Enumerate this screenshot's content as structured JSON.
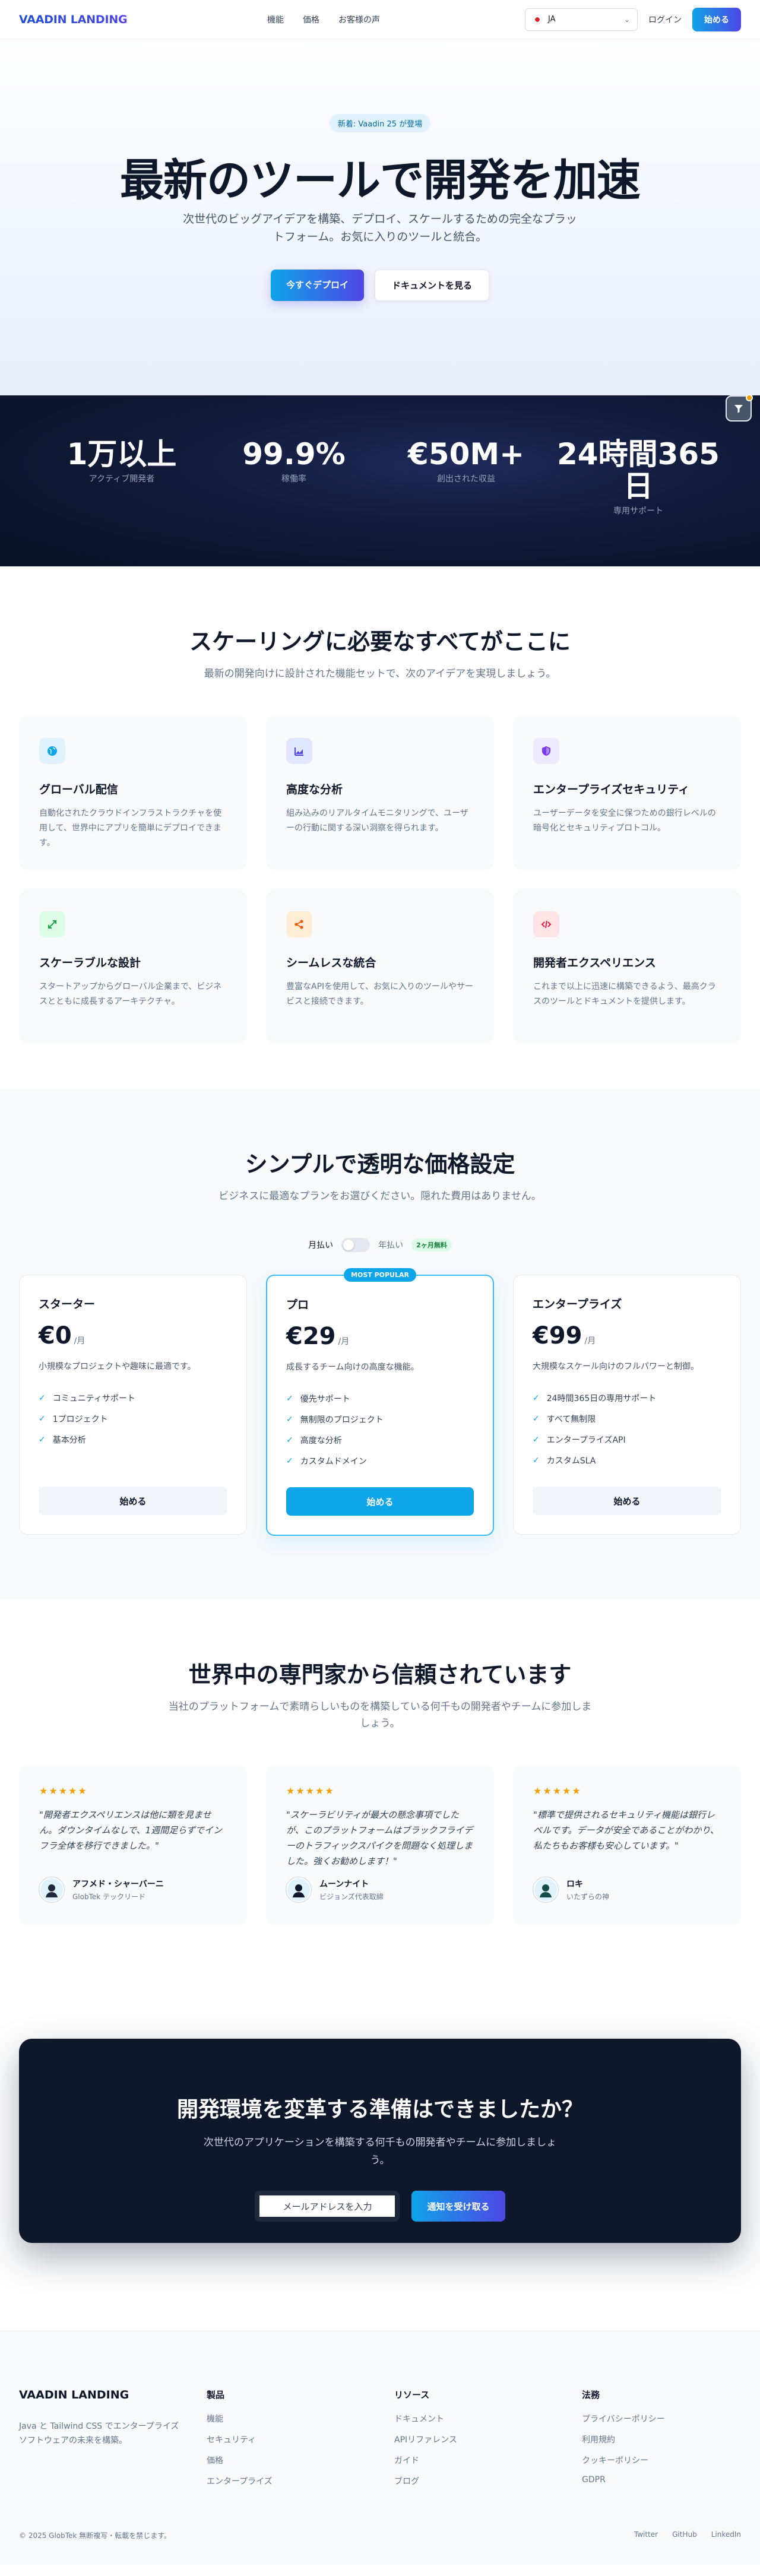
{
  "nav": {
    "logo": "VAADIN LANDING",
    "links": [
      "機能",
      "価格",
      "お客様の声"
    ],
    "language": "JA",
    "login": "ログイン",
    "start": "始める"
  },
  "hero": {
    "badge": "新着: Vaadin 25 が登場",
    "title": "最新のツールで開発を加速",
    "subtitle": "次世代のビッグアイデアを構築、デプロイ、スケールするための完全なプラットフォーム。お気に入りのツールと統合。",
    "primary_cta": "今すぐデプロイ",
    "secondary_cta": "ドキュメントを見る"
  },
  "stats": [
    {
      "value": "1万以上",
      "label": "アクティブ開発者"
    },
    {
      "value": "99.9%",
      "label": "稼働率"
    },
    {
      "value": "€50M+",
      "label": "創出された収益"
    },
    {
      "value": "24時間365日",
      "label": "専用サポート"
    }
  ],
  "features": {
    "title": "スケーリングに必要なすべてがここに",
    "subtitle": "最新の開発向けに設計された機能セットで、次のアイデアを実現しましょう。",
    "items": [
      {
        "icon": "globe-icon",
        "color": "#0ea5e9",
        "bg": "#e0f2fe",
        "title": "グローバル配信",
        "desc": "自動化されたクラウドインフラストラクチャを使用して、世界中にアプリを簡単にデプロイできます。"
      },
      {
        "icon": "chart-icon",
        "color": "#4f46e5",
        "bg": "#e0e7ff",
        "title": "高度な分析",
        "desc": "組み込みのリアルタイムモニタリングで、ユーザーの行動に関する深い洞察を得られます。"
      },
      {
        "icon": "shield-icon",
        "color": "#7c3aed",
        "bg": "#ede9fe",
        "title": "エンタープライズセキュリティ",
        "desc": "ユーザーデータを安全に保つための銀行レベルの暗号化とセキュリティプロトコル。"
      },
      {
        "icon": "scale-icon",
        "color": "#16a34a",
        "bg": "#dcfce7",
        "title": "スケーラブルな設計",
        "desc": "スタートアップからグローバル企業まで、ビジネスとともに成長するアーキテクチャ。"
      },
      {
        "icon": "share-icon",
        "color": "#ea580c",
        "bg": "#ffedd5",
        "title": "シームレスな統合",
        "desc": "豊富なAPIを使用して、お気に入りのツールやサービスと接続できます。"
      },
      {
        "icon": "code-icon",
        "color": "#e11d48",
        "bg": "#ffe4e6",
        "title": "開発者エクスペリエンス",
        "desc": "これまで以上に迅速に構築できるよう、最高クラスのツールとドキュメントを提供します。"
      }
    ]
  },
  "pricing": {
    "title": "シンプルで透明な価格設定",
    "subtitle": "ビジネスに最適なプランをお選びください。隠れた費用はありません。",
    "monthly": "月払い",
    "yearly": "年払い",
    "save": "2ヶ月無料",
    "popular": "MOST POPULAR",
    "plans": [
      {
        "name": "スターター",
        "price": "€0",
        "per": "/月",
        "desc": "小規模なプロジェクトや趣味に最適です。",
        "features": [
          "コミュニティサポート",
          "1プロジェクト",
          "基本分析"
        ],
        "cta": "始める"
      },
      {
        "name": "プロ",
        "price": "€29",
        "per": "/月",
        "desc": "成長するチーム向けの高度な機能。",
        "features": [
          "優先サポート",
          "無制限のプロジェクト",
          "高度な分析",
          "カスタムドメイン"
        ],
        "cta": "始める"
      },
      {
        "name": "エンタープライズ",
        "price": "€99",
        "per": "/月",
        "desc": "大規模なスケール向けのフルパワーと制御。",
        "features": [
          "24時間365日の専用サポート",
          "すべて無制限",
          "エンタープライズAPI",
          "カスタムSLA"
        ],
        "cta": "始める"
      }
    ]
  },
  "testimonials": {
    "title": "世界中の専門家から信頼されています",
    "subtitle": "当社のプラットフォームで素晴らしいものを構築している何千もの開発者やチームに参加しましょう。",
    "items": [
      {
        "stars": "★★★★★",
        "quote": "\"開発者エクスペリエンスは他に類を見ません。ダウンタイムなしで、1週間足らずでインフラ全体を移行できました。\"",
        "name": "アフメド・シャーバーニ",
        "role": "GlobTek テックリード"
      },
      {
        "stars": "★★★★★",
        "quote": "\"スケーラビリティが最大の懸念事項でしたが、このプラットフォームはブラックフライデーのトラフィックスパイクを問題なく処理しました。強くお勧めします！\"",
        "name": "ムーンナイト",
        "role": "ビジョンズ代表取締"
      },
      {
        "stars": "★★★★★",
        "quote": "\"標準で提供されるセキュリティ機能は銀行レベルです。データが安全であることがわかり、私たちもお客様も安心しています。\"",
        "name": "ロキ",
        "role": "いたずらの神"
      }
    ]
  },
  "cta": {
    "title": "開発環境を変革する準備はできましたか？",
    "subtitle": "次世代のアプリケーションを構築する何千もの開発者やチームに参加しましょう。",
    "email_placeholder": "メールアドレスを入力",
    "button": "通知を受け取る"
  },
  "footer": {
    "logo": "VAADIN LANDING",
    "tagline": "Java と Tailwind CSS でエンタープライズソフトウェアの未来を構築。",
    "columns": [
      {
        "title": "製品",
        "links": [
          "機能",
          "セキュリティ",
          "価格",
          "エンタープライズ"
        ]
      },
      {
        "title": "リソース",
        "links": [
          "ドキュメント",
          "APIリファレンス",
          "ガイド",
          "ブログ"
        ]
      },
      {
        "title": "法務",
        "links": [
          "プライバシーポリシー",
          "利用規約",
          "クッキーポリシー",
          "GDPR"
        ]
      }
    ],
    "copyright": "© 2025 GlobTek 無断複写・転載を禁じます。",
    "social": [
      "Twitter",
      "GitHub",
      "LinkedIn"
    ]
  }
}
